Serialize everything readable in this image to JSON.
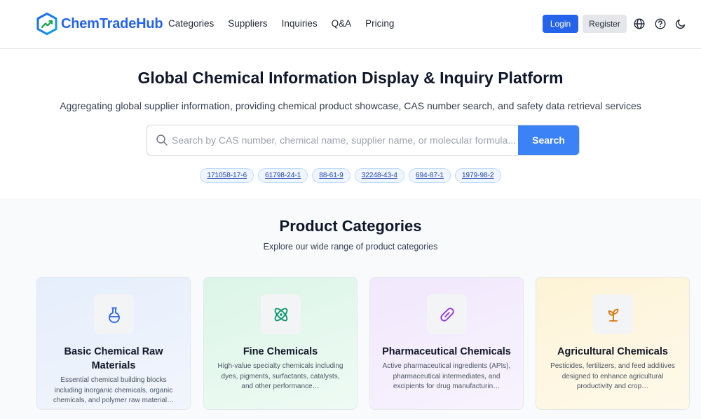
{
  "brand": {
    "name": "ChemTradeHub",
    "accent": "#2563eb"
  },
  "nav": {
    "links": [
      "Categories",
      "Suppliers",
      "Inquiries",
      "Q&A",
      "Pricing"
    ],
    "login_label": "Login",
    "register_label": "Register",
    "icons": [
      "globe-icon",
      "help-circle-icon",
      "moon-icon"
    ]
  },
  "hero": {
    "title": "Global Chemical Information Display & Inquiry Platform",
    "subtitle": "Aggregating global supplier information, providing chemical product showcase, CAS number search, and safety data retrieval services",
    "search": {
      "value": "",
      "placeholder": "Search by CAS number, chemical name, supplier name, or molecular formula...",
      "button_label": "Search"
    },
    "cas_chips": [
      "171058-17-6",
      "61798-24-1",
      "88-61-9",
      "32248-43-4",
      "694-87-1",
      "1979-98-2"
    ]
  },
  "categories": {
    "title": "Product Categories",
    "subtitle": "Explore our wide range of product categories",
    "items": [
      {
        "name": "Basic Chemical Raw Materials",
        "description": "Essential chemical building blocks including inorganic chemicals, organic chemicals, and polymer raw material…",
        "icon": "flask-icon",
        "color": "#2563eb"
      },
      {
        "name": "Fine Chemicals",
        "description": "High-value specialty chemicals including dyes, pigments, surfactants, catalysts, and other performance…",
        "icon": "atom-icon",
        "color": "#059669"
      },
      {
        "name": "Pharmaceutical Chemicals",
        "description": "Active pharmaceutical ingredients (APIs), pharmaceutical intermediates, and excipients for drug manufacturin…",
        "icon": "pill-icon",
        "color": "#9333ea"
      },
      {
        "name": "Agricultural Chemicals",
        "description": "Pesticides, fertilizers, and feed additives designed to enhance agricultural productivity and crop…",
        "icon": "sprout-icon",
        "color": "#d97706"
      }
    ]
  }
}
